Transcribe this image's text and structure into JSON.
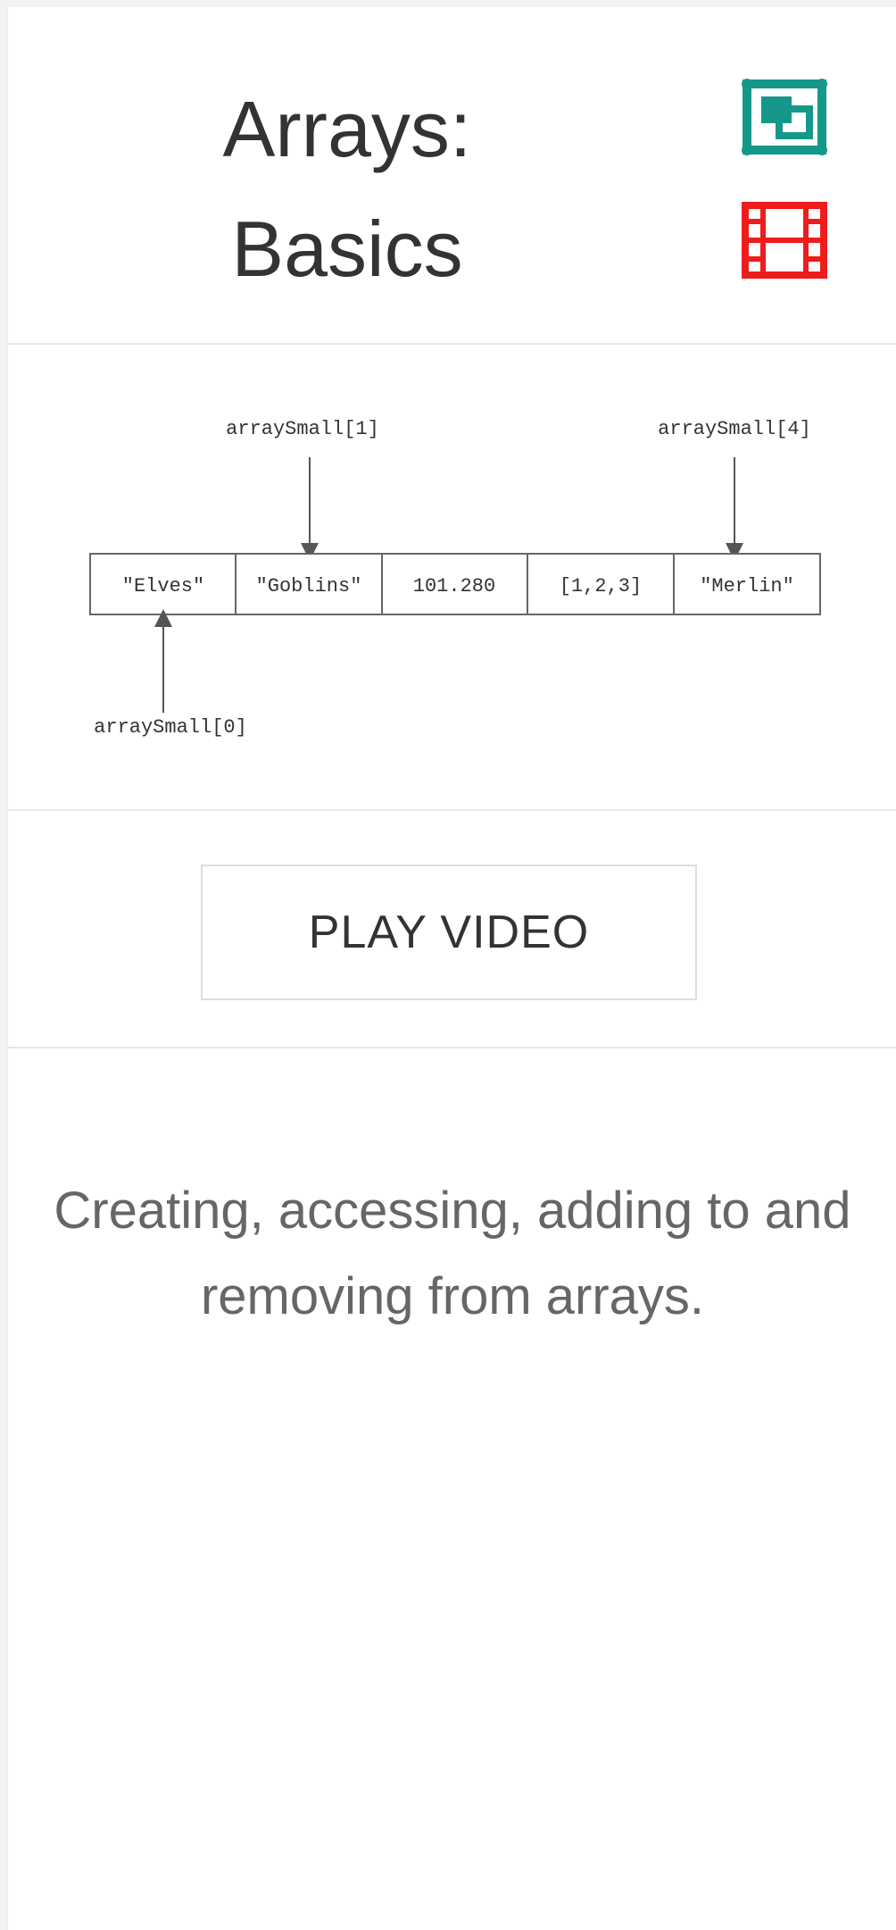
{
  "lesson": {
    "title_line1": "Arrays:",
    "title_line2": "Basics",
    "icons": {
      "first": "screen-expand-icon",
      "second": "film-icon"
    },
    "colors": {
      "teal": "#15988a",
      "red": "#ef1c1c"
    }
  },
  "diagram": {
    "cells": [
      "\"Elves\"",
      "\"Goblins\"",
      "101.280",
      "[1,2,3]",
      "\"Merlin\""
    ],
    "labels": {
      "index0": "arraySmall[0]",
      "index1": "arraySmall[1]",
      "index4": "arraySmall[4]"
    }
  },
  "actions": {
    "play_label": "PLAY VIDEO"
  },
  "description": "Creating, accessing, adding to and removing from arrays."
}
